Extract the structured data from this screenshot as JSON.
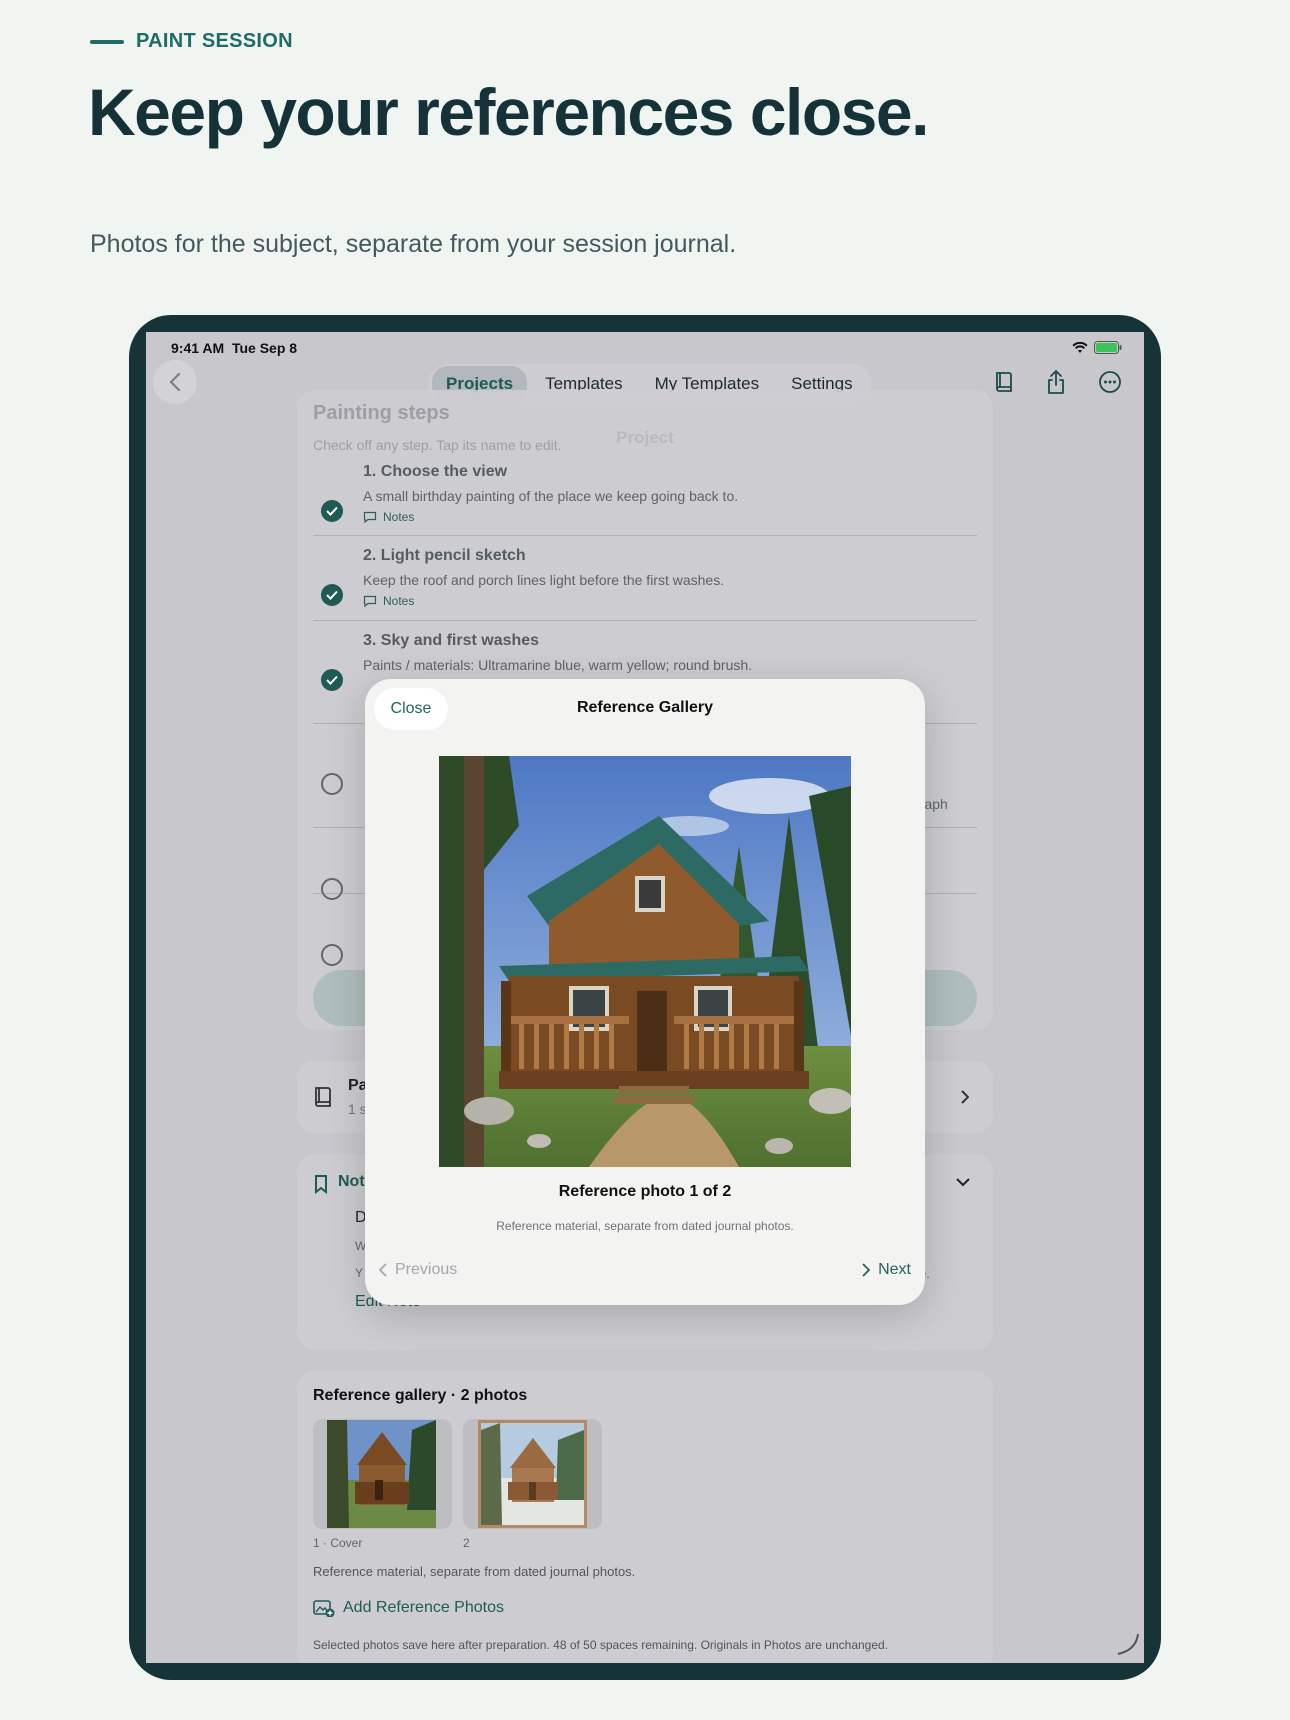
{
  "page": {
    "eyebrow": "PAINT SESSION",
    "headline": "Keep your references close.",
    "subhead": "Photos for the subject, separate from your session journal."
  },
  "status": {
    "time": "9:41 AM",
    "date": "Tue Sep 8"
  },
  "nav": {
    "tabs": [
      {
        "label": "Projects",
        "active": true
      },
      {
        "label": "Templates"
      },
      {
        "label": "My Templates"
      },
      {
        "label": "Settings"
      }
    ],
    "title": "Project"
  },
  "steps_card": {
    "heading": "Painting steps",
    "hint": "Check off any step. Tap its name to edit.",
    "steps": [
      {
        "title": "1. Choose the view",
        "desc": "A small birthday painting of the place we keep going back to.",
        "notes": "Notes",
        "done": true
      },
      {
        "title": "2. Light pencil sketch",
        "desc": "Keep the roof and porch lines light before the first washes.",
        "notes": "Notes",
        "done": true
      },
      {
        "title": "3. Sky and first washes",
        "desc": "Paints / materials: Ultramarine blue, warm yellow; round brush.",
        "done": true
      },
      {
        "tail": "graph"
      }
    ]
  },
  "journal_card": {
    "title": "Pa",
    "sub": "1 s"
  },
  "notes_card": {
    "title": "Not",
    "line1": "D",
    "line2": "W",
    "line3": "Y",
    "tail": "e.",
    "edit": "Edit Note"
  },
  "gallery_card": {
    "title": "Reference gallery · 2 photos",
    "thumbs": [
      {
        "label": "1 · Cover"
      },
      {
        "label": "2"
      }
    ],
    "caption": "Reference material, separate from dated journal photos.",
    "add": "Add Reference Photos",
    "footer": "Selected photos save here after preparation. 48 of 50 spaces remaining. Originals in Photos are unchanged."
  },
  "modal": {
    "close": "Close",
    "title": "Reference Gallery",
    "caption": "Reference photo 1 of 2",
    "sub": "Reference material, separate from dated journal photos.",
    "prev": "Previous",
    "next": "Next"
  },
  "colors": {
    "accent": "#1f6b66",
    "device": "#163338",
    "background": "#f1f5f2"
  }
}
